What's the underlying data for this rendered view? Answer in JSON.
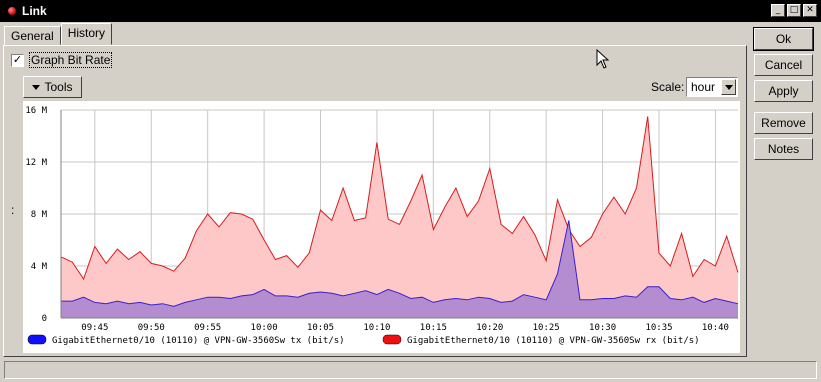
{
  "window": {
    "title": "Link"
  },
  "tabs": [
    {
      "label": "General"
    },
    {
      "label": "History"
    }
  ],
  "controls": {
    "graph_bit_rate_label": "Graph Bit Rate",
    "graph_bit_rate_checked": true,
    "tools_label": "Tools",
    "scale_label": "Scale:",
    "scale_value": "hour"
  },
  "buttons": {
    "ok": "Ok",
    "cancel": "Cancel",
    "apply": "Apply",
    "remove": "Remove",
    "notes": "Notes"
  },
  "misc": {
    "side_marker": ":"
  },
  "colors": {
    "tx_line": "#3a1fd0",
    "tx_fill": "#b48cd0",
    "rx_line": "#d81c1c",
    "rx_fill": "#ffc8c8",
    "grid": "#c8c8c8",
    "legend_tx": "#1010ff",
    "legend_rx": "#ee1010"
  },
  "chart_data": {
    "type": "area",
    "ylim": [
      0,
      16
    ],
    "yticks": [
      "0",
      "4 M",
      "8 M",
      "12 M",
      "16 M"
    ],
    "x": [
      "09:42",
      "09:43",
      "09:44",
      "09:45",
      "09:46",
      "09:47",
      "09:48",
      "09:49",
      "09:50",
      "09:51",
      "09:52",
      "09:53",
      "09:54",
      "09:55",
      "09:56",
      "09:57",
      "09:58",
      "09:59",
      "10:00",
      "10:01",
      "10:02",
      "10:03",
      "10:04",
      "10:05",
      "10:06",
      "10:07",
      "10:08",
      "10:09",
      "10:10",
      "10:11",
      "10:12",
      "10:13",
      "10:14",
      "10:15",
      "10:16",
      "10:17",
      "10:18",
      "10:19",
      "10:20",
      "10:21",
      "10:22",
      "10:23",
      "10:24",
      "10:25",
      "10:26",
      "10:27",
      "10:28",
      "10:29",
      "10:30",
      "10:31",
      "10:32",
      "10:33",
      "10:34",
      "10:35",
      "10:36",
      "10:37",
      "10:38",
      "10:39",
      "10:40",
      "10:41",
      "10:42"
    ],
    "xticks": [
      "09:45",
      "09:50",
      "09:55",
      "10:00",
      "10:05",
      "10:10",
      "10:15",
      "10:20",
      "10:25",
      "10:30",
      "10:35",
      "10:40"
    ],
    "series": [
      {
        "name": "GigabitEthernet0/10 (10110) @ VPN-GW-3560Sw rx (bit/s)",
        "values": [
          4.7,
          4.3,
          3.0,
          5.5,
          4.2,
          5.3,
          4.5,
          5.1,
          4.2,
          4.0,
          3.6,
          4.6,
          6.7,
          8.0,
          7.0,
          8.1,
          8.0,
          7.6,
          6.0,
          4.5,
          4.8,
          3.9,
          5.0,
          8.3,
          7.5,
          10.0,
          7.5,
          7.7,
          13.5,
          7.6,
          7.2,
          9.0,
          11.0,
          6.8,
          8.5,
          10.0,
          7.8,
          9.0,
          11.5,
          7.2,
          6.5,
          7.8,
          6.4,
          4.4,
          9.1,
          6.8,
          5.5,
          6.2,
          8.0,
          9.3,
          8.0,
          10.0,
          15.5,
          5.0,
          4.0,
          6.5,
          3.2,
          4.5,
          4.0,
          6.3,
          3.5
        ],
        "color": "#d81c1c"
      },
      {
        "name": "GigabitEthernet0/10 (10110) @ VPN-GW-3560Sw tx (bit/s)",
        "values": [
          1.3,
          1.3,
          1.6,
          1.2,
          1.1,
          1.3,
          1.1,
          1.2,
          1.0,
          1.1,
          0.9,
          1.2,
          1.4,
          1.6,
          1.6,
          1.5,
          1.7,
          1.8,
          2.2,
          1.7,
          1.7,
          1.6,
          1.9,
          2.0,
          1.9,
          1.7,
          1.9,
          2.1,
          1.8,
          2.2,
          1.9,
          1.5,
          1.6,
          1.2,
          1.4,
          1.5,
          1.4,
          1.6,
          1.5,
          1.2,
          1.3,
          1.8,
          1.6,
          1.4,
          3.4,
          7.5,
          1.4,
          1.4,
          1.5,
          1.5,
          1.7,
          1.6,
          2.4,
          2.4,
          1.5,
          1.4,
          1.6,
          1.2,
          1.5,
          1.3,
          1.1
        ],
        "color": "#3a1fd0"
      }
    ],
    "legend": [
      {
        "name": "GigabitEthernet0/10 (10110) @ VPN-GW-3560Sw tx (bit/s)"
      },
      {
        "name": "GigabitEthernet0/10 (10110) @ VPN-GW-3560Sw rx (bit/s)"
      }
    ],
    "grid": true
  }
}
